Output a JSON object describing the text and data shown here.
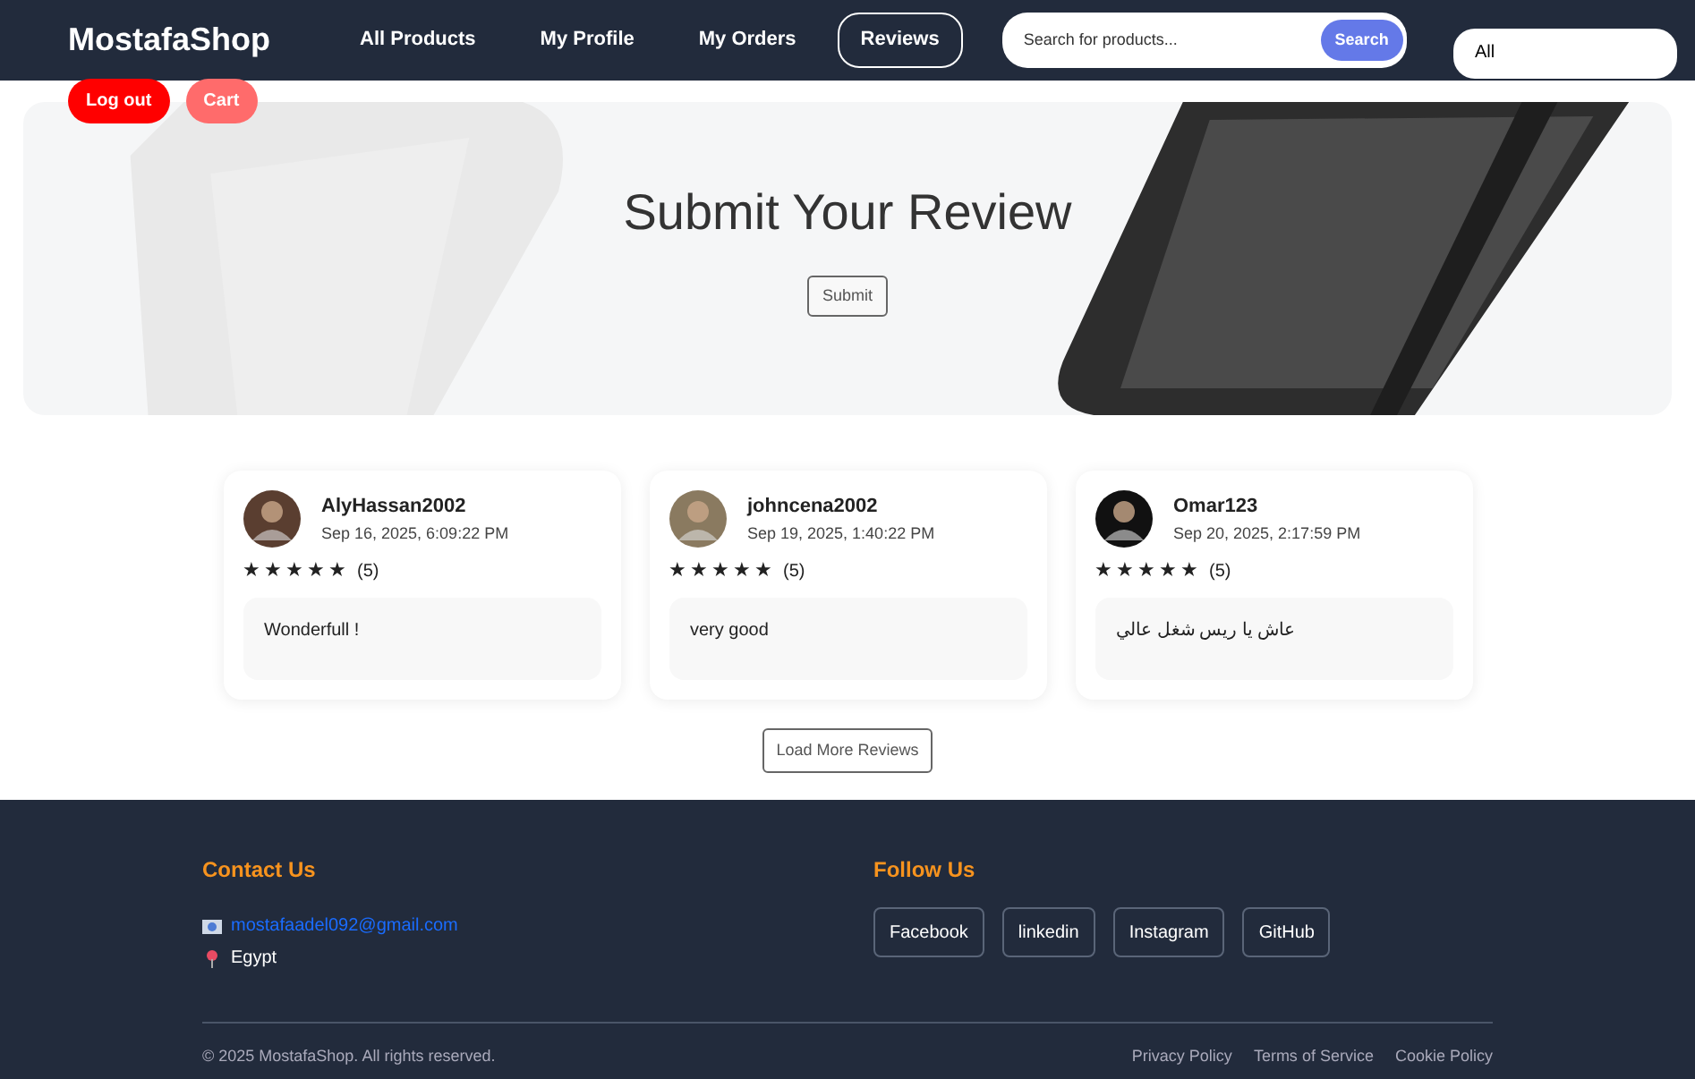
{
  "brand": "MostafaShop",
  "nav": [
    {
      "label": "All Products",
      "selected": false
    },
    {
      "label": "My Profile",
      "selected": false
    },
    {
      "label": "My Orders",
      "selected": false
    },
    {
      "label": "Reviews",
      "selected": true
    }
  ],
  "search": {
    "placeholder": "Search for products...",
    "button": "Search"
  },
  "category_select": {
    "value": "All"
  },
  "account_buttons": [
    {
      "label": "Log out",
      "kind": "logout"
    },
    {
      "label": "Cart",
      "kind": "cart"
    }
  ],
  "hero": {
    "title": "Submit Your Review",
    "button": "Submit"
  },
  "reviews": [
    {
      "user": "AlyHassan2002",
      "date": "Sep 16, 2025, 6:09:22 PM",
      "stars": 5,
      "count": "(5)",
      "text": "Wonderfull !"
    },
    {
      "user": "johncena2002",
      "date": "Sep 19, 2025, 1:40:22 PM",
      "stars": 5,
      "count": "(5)",
      "text": "very good"
    },
    {
      "user": "Omar123",
      "date": "Sep 20, 2025, 2:17:59 PM",
      "stars": 5,
      "count": "(5)",
      "text": "عاش يا ريس شغل عالي"
    }
  ],
  "load_more": "Load More Reviews",
  "footer": {
    "contact_title": "Contact Us",
    "email": "mostafaadel092@gmail.com",
    "location": "Egypt",
    "follow_title": "Follow Us",
    "social": [
      "Facebook",
      "linkedin",
      "Instagram",
      "GitHub"
    ],
    "copyright": "© 2025 MostafaShop. All rights reserved.",
    "links": [
      "Privacy Policy",
      "Terms of Service",
      "Cookie Policy"
    ]
  }
}
